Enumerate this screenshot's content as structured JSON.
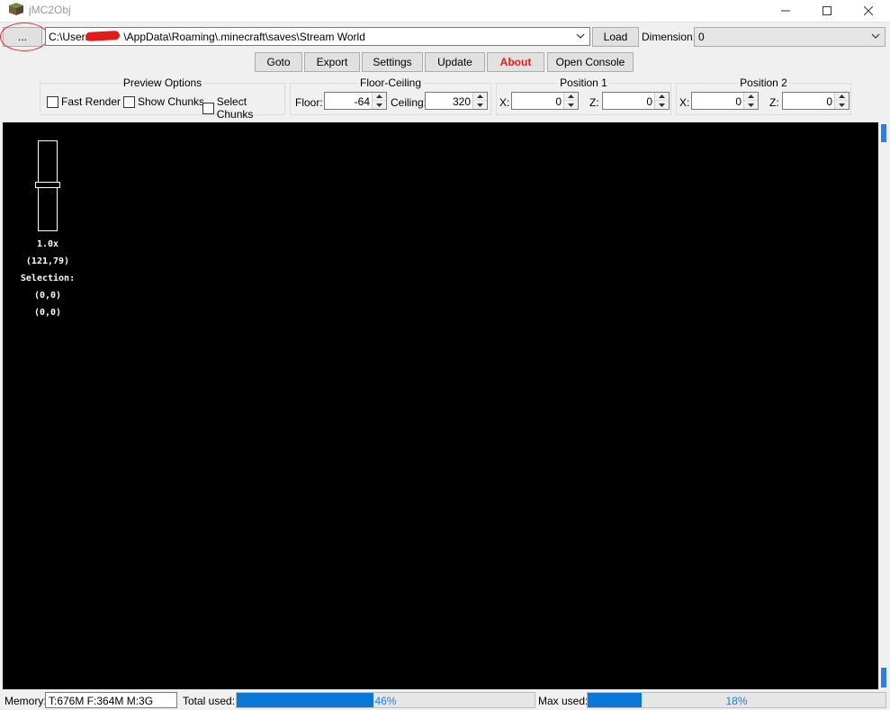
{
  "window": {
    "title": "jMC2Obj",
    "minimize_glyph": "—",
    "maximize_glyph": "☐",
    "close_glyph": "✕"
  },
  "toolbar": {
    "browse_label": "...",
    "path_value": "C:\\Users\\          \\AppData\\Roaming\\.minecraft\\saves\\Stream World",
    "load_label": "Load",
    "dimension_label": "Dimension:",
    "dimension_value": "0",
    "buttons": {
      "goto": "Goto",
      "export": "Export",
      "settings": "Settings",
      "update": "Update",
      "about": "About",
      "open_console": "Open Console"
    }
  },
  "preview_options": {
    "title": "Preview Options",
    "fast_render": "Fast Render",
    "show_chunks": "Show Chunks",
    "select_chunks": "Select Chunks"
  },
  "floor_ceiling": {
    "title": "Floor-Ceiling",
    "floor_label": "Floor:",
    "floor_value": "-64",
    "ceiling_label": "Ceiling:",
    "ceiling_value": "320"
  },
  "position1": {
    "title": "Position 1",
    "x_label": "X:",
    "x_value": "0",
    "z_label": "Z:",
    "z_value": "0"
  },
  "position2": {
    "title": "Position 2",
    "x_label": "X:",
    "x_value": "0",
    "z_label": "Z:",
    "z_value": "0"
  },
  "overlay": {
    "zoom": "1.0x",
    "cursor": "(121,79)",
    "selection_label": "Selection:",
    "selection_start": "(0,0)",
    "selection_end": "(0,0)",
    "zoom_level_fraction": 0.5
  },
  "status": {
    "memory_label": "Memory:",
    "memory_value": "T:676M F:364M M:3G",
    "total_used_label": "Total used:",
    "total_used_text": "46%",
    "total_used_percent": 46,
    "max_used_label": "Max used:",
    "max_used_text": "18%",
    "max_used_percent": 18
  },
  "colors": {
    "accent": "#0a78d7",
    "about_text": "#e0201f",
    "annotation": "#e03030",
    "viewport_bg": "#000000"
  }
}
